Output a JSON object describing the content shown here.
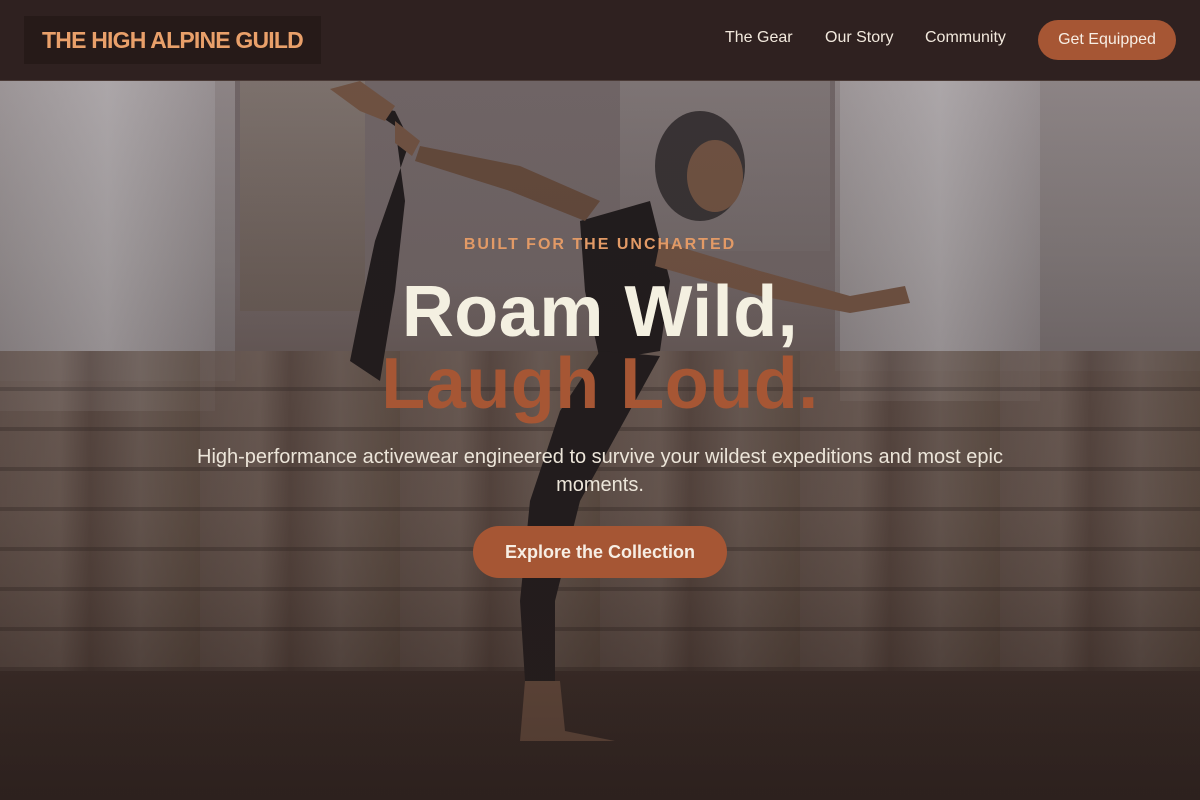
{
  "brand": {
    "name": "THE HIGH ALPINE GUILD",
    "accent_color": "#a65634",
    "logo_color": "#e9a06a"
  },
  "nav": {
    "items": [
      {
        "label": "The Gear"
      },
      {
        "label": "Our Story"
      },
      {
        "label": "Community"
      }
    ],
    "cta_label": "Get Equipped"
  },
  "hero": {
    "eyebrow": "BUILT FOR THE UNCHARTED",
    "headline_line1": "Roam Wild,",
    "headline_line2": "Laugh Loud.",
    "subtitle": "High-performance activewear engineered to survive your wildest expeditions and most epic moments.",
    "button_label": "Explore the Collection"
  }
}
